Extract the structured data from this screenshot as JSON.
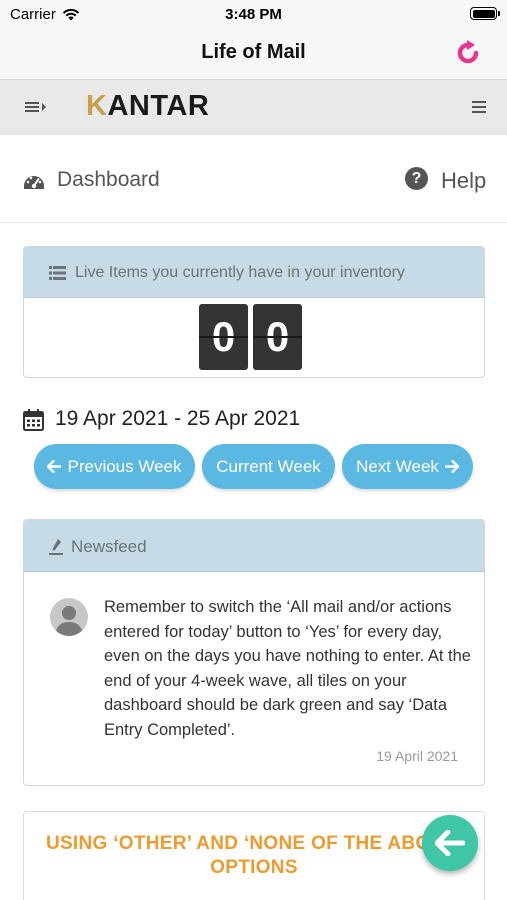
{
  "status_bar": {
    "carrier": "Carrier",
    "time": "3:48 PM"
  },
  "nav": {
    "title": "Life of Mail",
    "refresh_icon": "refresh-icon"
  },
  "header": {
    "logo_main": "ANTAR",
    "logo_k": "K"
  },
  "page": {
    "dashboard_label": "Dashboard",
    "help_label": "Help",
    "help_glyph": "?"
  },
  "inventory": {
    "title": "Live Items you currently have in your inventory",
    "digits": [
      "0",
      "0"
    ]
  },
  "week": {
    "date_range": "19 Apr 2021 - 25 Apr 2021",
    "prev_label": "Previous Week",
    "current_label": "Current Week",
    "next_label": "Next Week"
  },
  "newsfeed": {
    "title": "Newsfeed",
    "message": "Remember to switch the ‘All mail and/or actions entered for today’ button to ‘Yes’ for every day, even on the days you have nothing to enter. At the end of your 4-week wave, all tiles on your dashboard should be dark green and say ‘Data Entry Completed’.",
    "date": "19 April 2021"
  },
  "card": {
    "title": "USING ‘OTHER’ AND ‘NONE OF THE ABOVE’ OPTIONS"
  },
  "colors": {
    "accent_blue": "#5bb8e3",
    "panel_header": "#c6dbe6",
    "card_title": "#ef9a2e",
    "fab": "#3ec6a6",
    "refresh": "#e8348f"
  }
}
